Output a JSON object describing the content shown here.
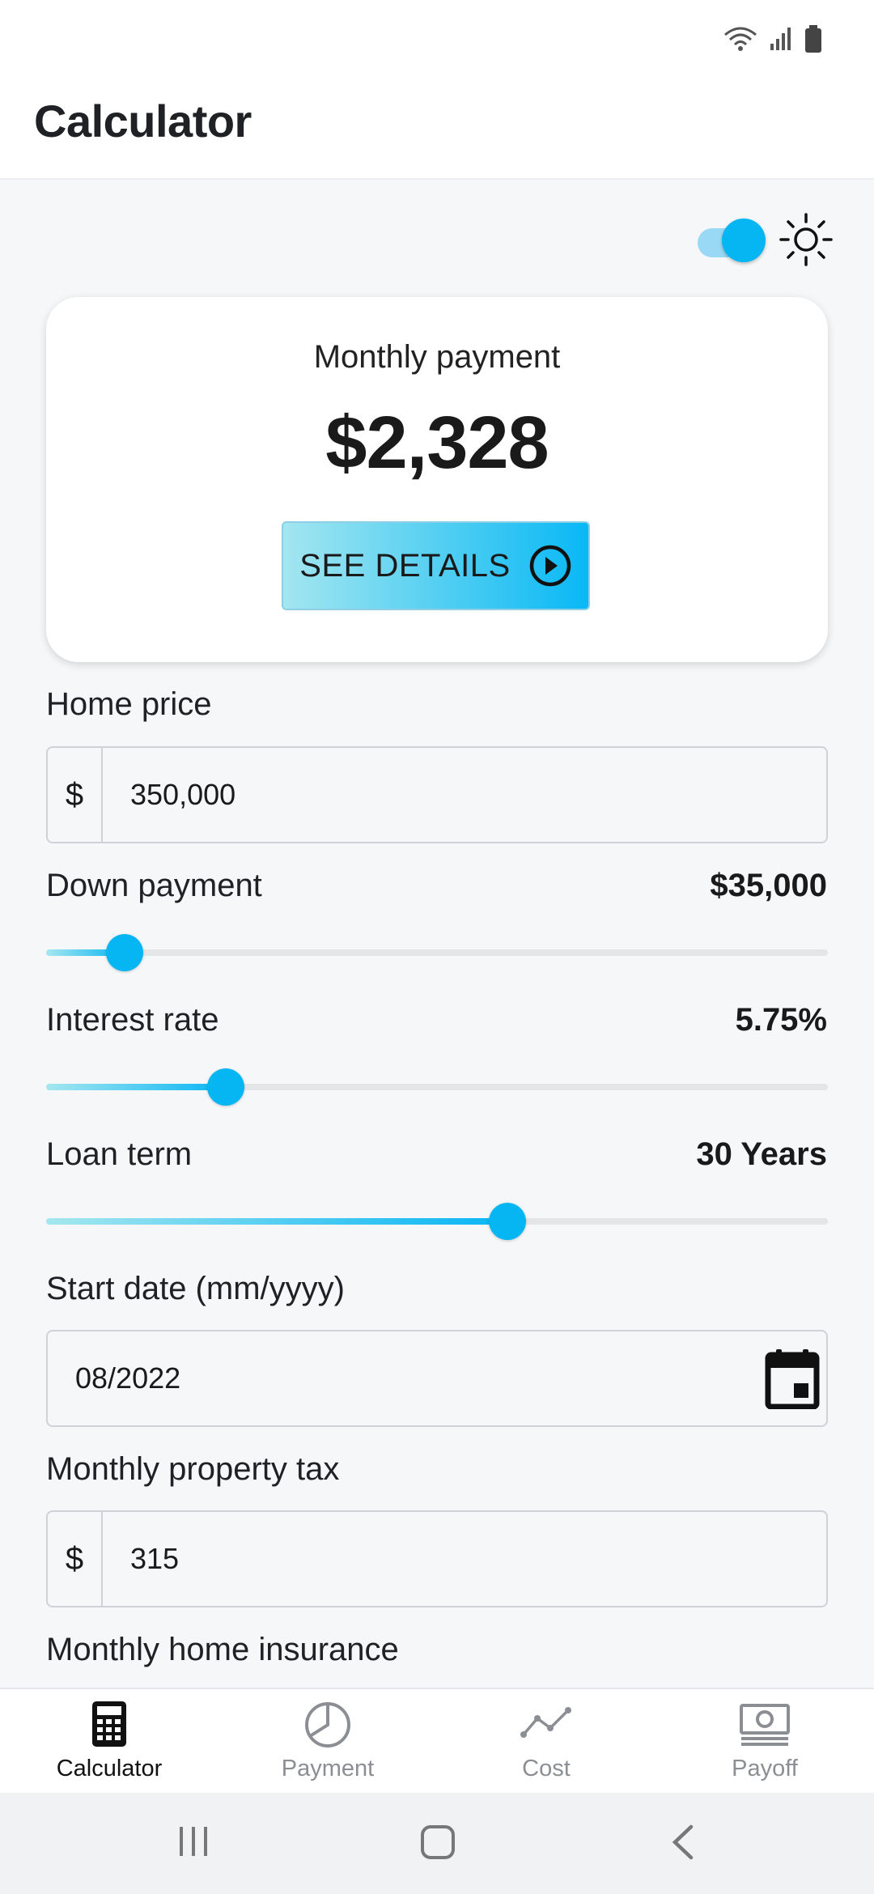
{
  "app": {
    "title": "Calculator"
  },
  "theme": {
    "toggle_on": true,
    "icon": "sun-icon"
  },
  "summary": {
    "label": "Monthly payment",
    "amount": "$2,328",
    "details_button": "SEE DETAILS"
  },
  "fields": {
    "home_price": {
      "label": "Home price",
      "prefix": "$",
      "value": "350,000"
    },
    "down_payment": {
      "label": "Down payment",
      "value": "$35,000",
      "slider_fraction": 0.1
    },
    "interest_rate": {
      "label": "Interest rate",
      "value": "5.75%",
      "slider_fraction": 0.23
    },
    "loan_term": {
      "label": "Loan term",
      "value": "30 Years",
      "slider_fraction": 0.59
    },
    "start_date": {
      "label": "Start date (mm/yyyy)",
      "value": "08/2022"
    },
    "property_tax": {
      "label": "Monthly property tax",
      "prefix": "$",
      "value": "315"
    },
    "home_insurance": {
      "label": "Monthly home insurance"
    }
  },
  "bottom_nav": {
    "items": [
      {
        "label": "Calculator",
        "icon": "calculator-icon",
        "active": true
      },
      {
        "label": "Payment",
        "icon": "pie-chart-icon",
        "active": false
      },
      {
        "label": "Cost",
        "icon": "line-chart-icon",
        "active": false
      },
      {
        "label": "Payoff",
        "icon": "money-icon",
        "active": false
      }
    ]
  },
  "colors": {
    "accent": "#06b6f2",
    "accent_light": "#a3e6f0",
    "background": "#f6f7f9",
    "card": "#ffffff"
  }
}
